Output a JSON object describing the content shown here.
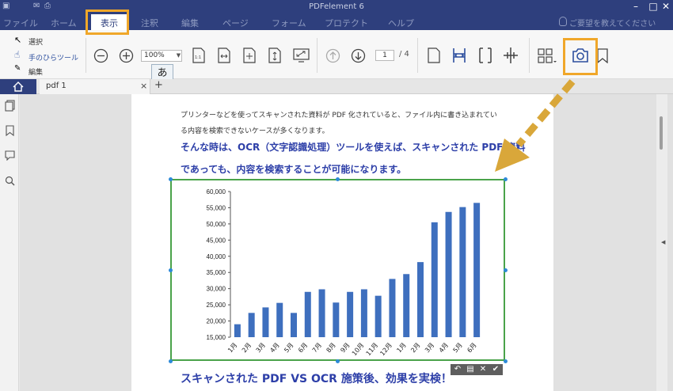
{
  "app": {
    "title": "PDFelement 6",
    "help_hint": "ご要望を教えてください"
  },
  "menu": {
    "items": [
      {
        "label": "ファイル"
      },
      {
        "label": "ホーム"
      },
      {
        "label": "表示"
      },
      {
        "label": "注釈"
      },
      {
        "label": "編集"
      },
      {
        "label": "ページ"
      },
      {
        "label": "フォーム"
      },
      {
        "label": "プロテクト"
      },
      {
        "label": "ヘルプ"
      }
    ],
    "active": "表示"
  },
  "ribbon": {
    "modes": {
      "select": "選択",
      "hand": "手のひらツール",
      "edit": "編集"
    },
    "zoom": "100%",
    "page_current": "1",
    "page_total": "/ 4",
    "ime_hint": "あ"
  },
  "tabs": {
    "document": "pdf 1",
    "close_symbol": "×",
    "add_symbol": "+"
  },
  "document": {
    "paragraph_lines": [
      "プリンターなどを使ってスキャンされた資料が PDF 化されていると、ファイル内に書き込まれてい",
      "る内容を検索できないケースが多くなります。"
    ],
    "emphasis_lines": [
      "そんな時は、OCR（文字認識処理）ツールを使えば、スキャンされた PDF 資料",
      "であっても、内容を検索することが可能になります。"
    ],
    "heading_bottom": "スキャンされた PDF VS OCR 施策後、効果を実検！"
  },
  "colors": {
    "accent_navy": "#2e3f7d",
    "highlight_orange": "#f0a72a",
    "bar_blue": "#3e6fbe",
    "text_blue": "#2d3fa8",
    "selection_green": "#4aa34a"
  },
  "icons": {
    "snapshot": "camera-icon",
    "bookmark": "bookmark-icon",
    "arrow": "dashed-arrow"
  },
  "chart_data": {
    "type": "bar",
    "categories": [
      "1月",
      "2月",
      "3月",
      "4月",
      "5月",
      "6月",
      "7月",
      "8月",
      "9月",
      "10月",
      "11月",
      "12月",
      "1月",
      "2月",
      "3月",
      "4月",
      "5月",
      "6月"
    ],
    "values": [
      19000,
      22500,
      24200,
      25600,
      22500,
      29000,
      29800,
      25700,
      29000,
      29800,
      27800,
      33000,
      34500,
      38200,
      50500,
      53700,
      55200,
      56500
    ],
    "ylim": [
      15000,
      60000
    ],
    "yticks": [
      "15,000",
      "20,000",
      "25,000",
      "30,000",
      "35,000",
      "40,000",
      "45,000",
      "50,000",
      "55,000",
      "60,000"
    ],
    "ytick_values": [
      15000,
      20000,
      25000,
      30000,
      35000,
      40000,
      45000,
      50000,
      55000,
      60000
    ],
    "title": "",
    "xlabel": "",
    "ylabel": "",
    "grid": false
  }
}
